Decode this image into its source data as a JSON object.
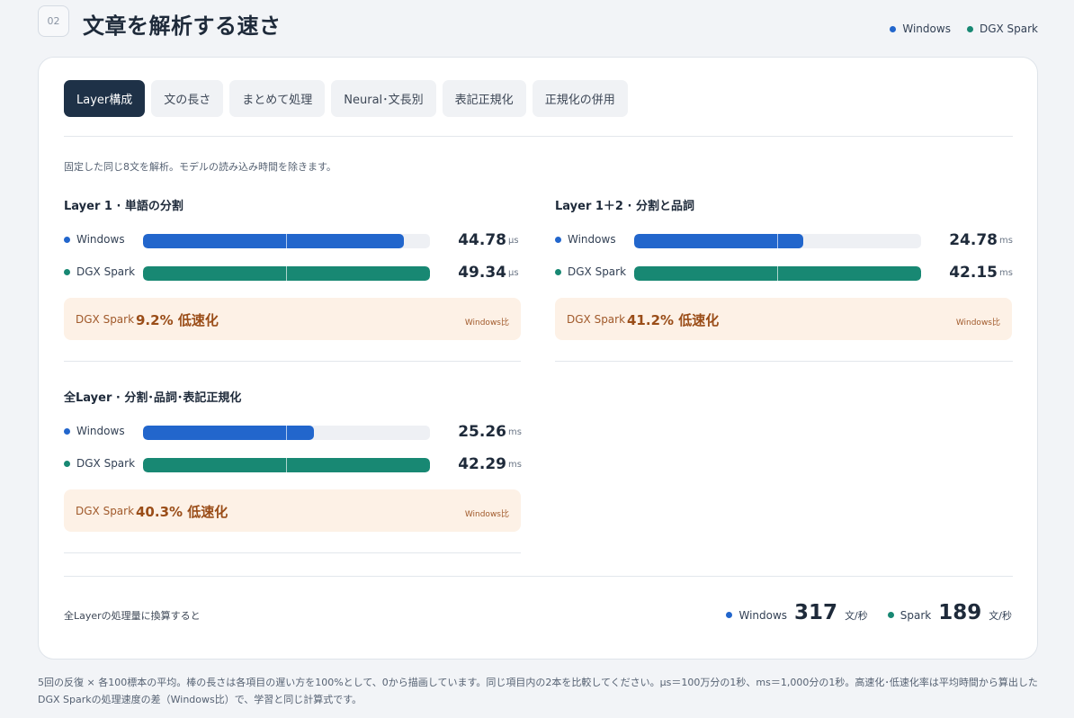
{
  "header": {
    "section_num": "02",
    "title": "文章を解析する速さ"
  },
  "legend": [
    {
      "label": "Windows",
      "color": "#2266cc"
    },
    {
      "label": "DGX Spark",
      "color": "#188873"
    }
  ],
  "tabs": [
    {
      "label": "Layer構成",
      "active": true
    },
    {
      "label": "文の長さ"
    },
    {
      "label": "まとめて処理"
    },
    {
      "label": "Neural･文長別"
    },
    {
      "label": "表記正規化"
    },
    {
      "label": "正規化の併用"
    }
  ],
  "note": "固定した同じ8文を解析。モデルの読み込み時間を除きます。",
  "panels": [
    {
      "title": "Layer 1 · 単語の分割",
      "rows": [
        {
          "name": "Windows",
          "value": "44.78",
          "unit": "μs",
          "fill": 0.908
        },
        {
          "name": "DGX Spark",
          "value": "49.34",
          "unit": "μs",
          "fill": 1.0
        }
      ],
      "compare": {
        "who": "DGX Spark",
        "text": "9.2% 低速化",
        "ratio": "Windows比"
      }
    },
    {
      "title": "Layer 1＋2 · 分割と品詞",
      "rows": [
        {
          "name": "Windows",
          "value": "24.78",
          "unit": "ms",
          "fill": 0.588
        },
        {
          "name": "DGX Spark",
          "value": "42.15",
          "unit": "ms",
          "fill": 1.0
        }
      ],
      "compare": {
        "who": "DGX Spark",
        "text": "41.2% 低速化",
        "ratio": "Windows比"
      }
    },
    {
      "title": "全Layer · 分割･品詞･表記正規化",
      "rows": [
        {
          "name": "Windows",
          "value": "25.26",
          "unit": "ms",
          "fill": 0.597
        },
        {
          "name": "DGX Spark",
          "value": "42.29",
          "unit": "ms",
          "fill": 1.0
        }
      ],
      "compare": {
        "who": "DGX Spark",
        "text": "40.3% 低速化",
        "ratio": "Windows比"
      }
    }
  ],
  "throughput": {
    "label": "全Layerの処理量に換算すると",
    "items": [
      {
        "name": "Windows",
        "value": "317",
        "unit": "文/秒"
      },
      {
        "name": "Spark",
        "value": "189",
        "unit": "文/秒"
      }
    ]
  },
  "footnote": "5回の反復 × 各100標本の平均。棒の長さは各項目の遅い方を100%として、0から描画しています。同じ項目内の2本を比較してください。μs＝100万分の1秒、ms＝1,000分の1秒。高速化･低速化率は平均時間から算出したDGX Sparkの処理速度の差（Windows比）で、学習と同じ計算式です。"
}
